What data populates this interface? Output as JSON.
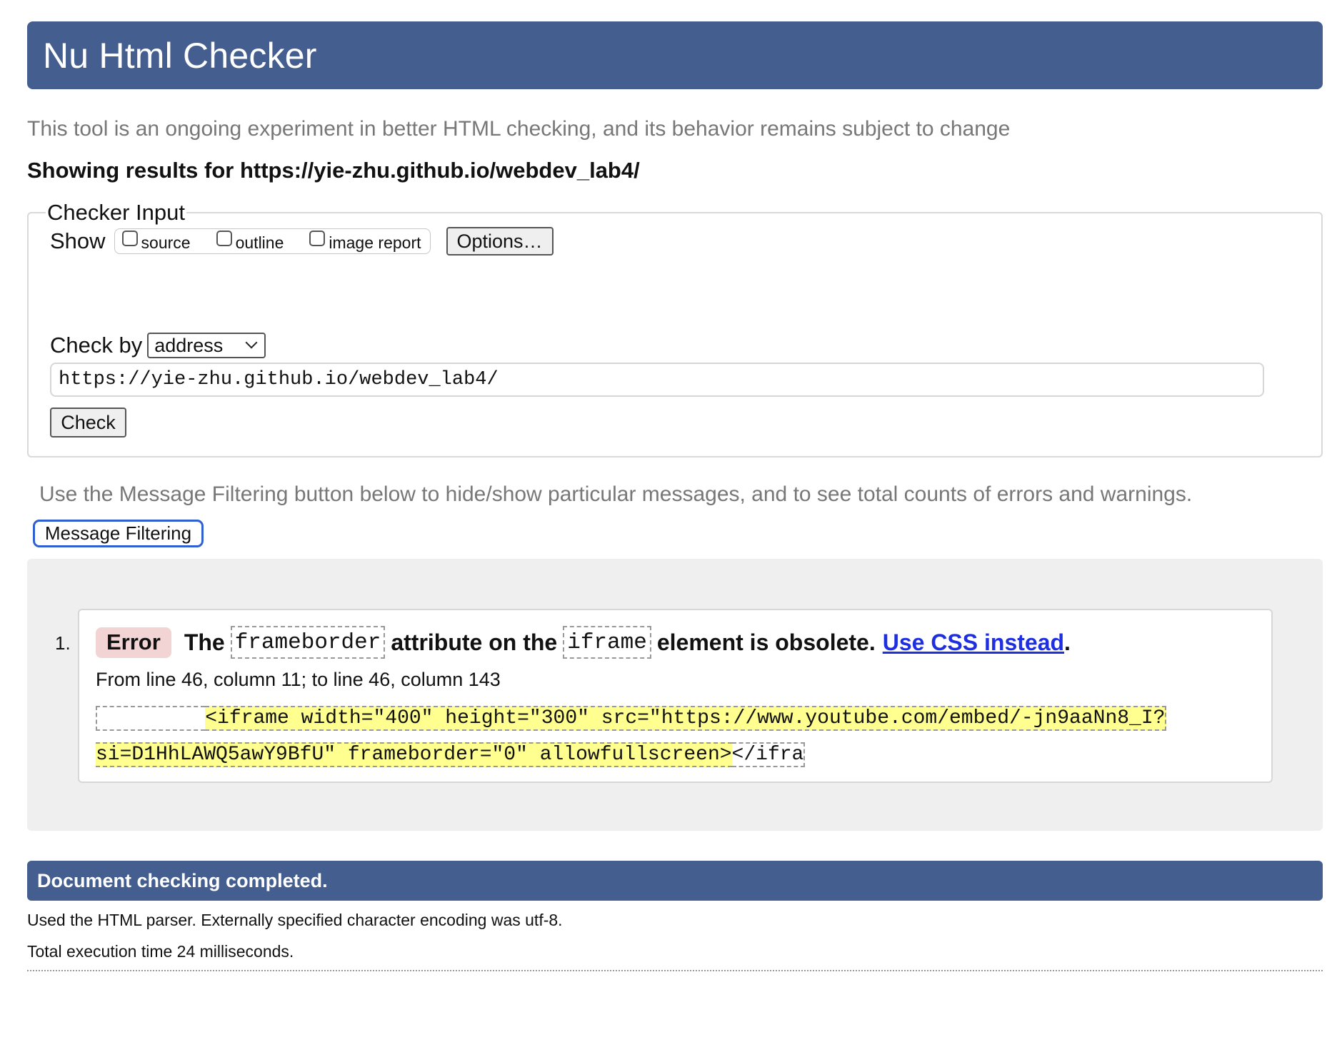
{
  "header": {
    "title": "Nu Html Checker"
  },
  "intro": "This tool is an ongoing experiment in better HTML checking, and its behavior remains subject to change",
  "results_for": {
    "label": "Showing results for ",
    "url": "https://yie-zhu.github.io/webdev_lab4/"
  },
  "checker_input": {
    "legend": "Checker Input",
    "show_label": "Show",
    "checkboxes": [
      {
        "label": "source",
        "checked": false
      },
      {
        "label": "outline",
        "checked": false
      },
      {
        "label": "image report",
        "checked": false
      }
    ],
    "options_button": "Options…",
    "check_by_label": "Check by",
    "check_by_value": "address",
    "url_value": "https://yie-zhu.github.io/webdev_lab4/",
    "check_button": "Check"
  },
  "filter_note": "Use the Message Filtering button below to hide/show particular messages, and to see total counts of errors and warnings.",
  "message_filtering_button": "Message Filtering",
  "messages": [
    {
      "number": "1.",
      "type": "Error",
      "text_parts": {
        "part1": "The",
        "code1": "frameborder",
        "part2": "attribute on the",
        "code2": "iframe",
        "part3": "element is obsolete.",
        "link": "Use CSS instead",
        "part4": "."
      },
      "location": "From line 46, column 11; to line 46, column 143",
      "extract": {
        "line1_lead": "         ",
        "line1_highlight": "<iframe width=\"400\" height=\"300\" src=\"https://www.youtube.com/embed/-jn9aaNn8_I?",
        "line2_highlight": "si=D1HhLAWQ5awY9BfU\" frameborder=\"0\" allowfullscreen>",
        "line2_tail": "</ifra"
      }
    }
  ],
  "completed": {
    "title": "Document checking completed.",
    "parser_note": "Used the HTML parser. Externally specified character encoding was utf-8.",
    "execution_time": "Total execution time 24 milliseconds."
  },
  "colors": {
    "header_bg": "#445e8f",
    "error_badge_bg": "#f2d4d4",
    "highlight": "#ffff90",
    "link": "#1d2fe0",
    "focus_ring": "#2f5fd0"
  }
}
